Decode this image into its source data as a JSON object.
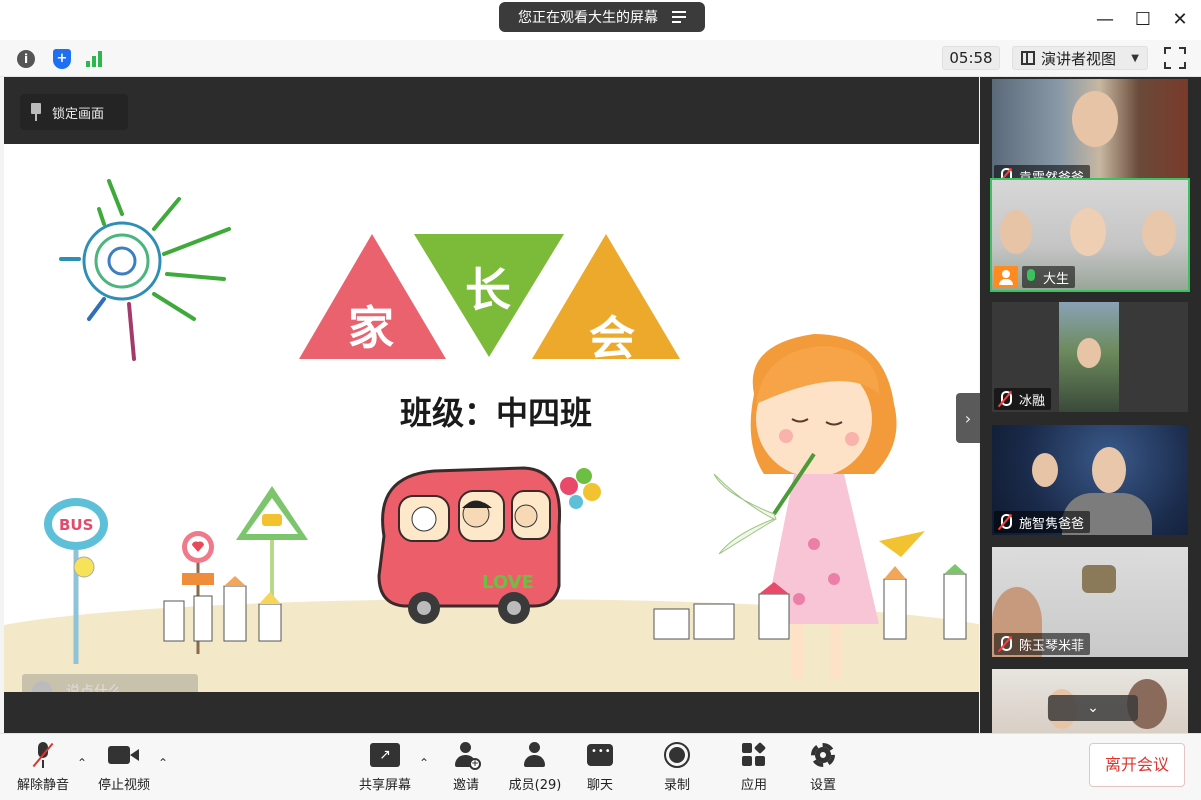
{
  "window": {
    "share_banner": "您正在观看大生的屏幕",
    "minimize": "—",
    "maximize": "☐",
    "close": "✕"
  },
  "toolbar": {
    "info_icon": "info-icon",
    "shield_icon": "shield-icon",
    "signal_icon": "signal-icon",
    "timer": "05:58",
    "view_mode": "演讲者视图"
  },
  "share_area": {
    "lock_view_label": "锁定画面",
    "slide": {
      "title_chars": [
        "家",
        "长",
        "会"
      ],
      "subtitle": "班级：中四班",
      "colors": {
        "pink": "#e9626e",
        "green": "#7cba3a",
        "orange": "#eca92b"
      }
    },
    "chat_placeholder": "说点什么...",
    "collapse": "›"
  },
  "gallery": {
    "participants": [
      {
        "name": "袁霈然爸爸",
        "muted": true,
        "host": false,
        "active": false
      },
      {
        "name": "大生",
        "muted": false,
        "host": true,
        "active": true
      },
      {
        "name": "冰融",
        "muted": true,
        "host": false,
        "active": false
      },
      {
        "name": "施智隽爸爸",
        "muted": true,
        "host": false,
        "active": false
      },
      {
        "name": "陈玉琴米菲",
        "muted": true,
        "host": false,
        "active": false
      }
    ],
    "scroll_down": "⌄"
  },
  "bottom": {
    "unmute": "解除静音",
    "stop_video": "停止视频",
    "share_screen": "共享屏幕",
    "invite": "邀请",
    "members": "成员(29)",
    "chat": "聊天",
    "record": "录制",
    "apps": "应用",
    "settings": "设置",
    "leave": "离开会议",
    "caret": "⌃"
  },
  "colors": {
    "accent_green": "#3cc15f",
    "leave_red": "#e0332c",
    "host_orange": "#ff8a1f"
  }
}
